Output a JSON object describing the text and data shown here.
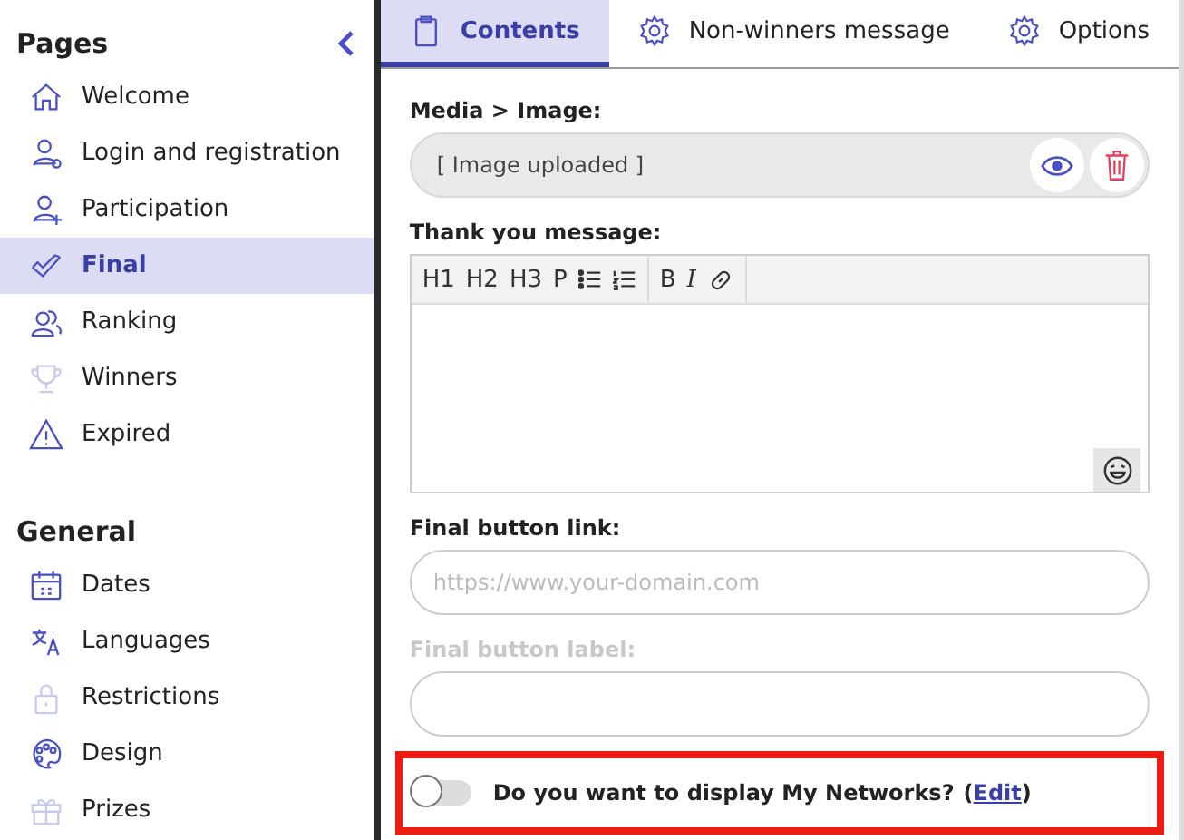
{
  "sidebar": {
    "sections": [
      {
        "title": "Pages",
        "items": [
          {
            "label": "Welcome",
            "icon_dimmed": false,
            "selected": false
          },
          {
            "label": "Login and registration",
            "icon_dimmed": false,
            "selected": false
          },
          {
            "label": "Participation",
            "icon_dimmed": false,
            "selected": false
          },
          {
            "label": "Final",
            "icon_dimmed": false,
            "selected": true
          },
          {
            "label": "Ranking",
            "icon_dimmed": false,
            "selected": false
          },
          {
            "label": "Winners",
            "icon_dimmed": true,
            "selected": false
          },
          {
            "label": "Expired",
            "icon_dimmed": false,
            "selected": false
          }
        ]
      },
      {
        "title": "General",
        "items": [
          {
            "label": "Dates",
            "icon_dimmed": false,
            "selected": false
          },
          {
            "label": "Languages",
            "icon_dimmed": false,
            "selected": false
          },
          {
            "label": "Restrictions",
            "icon_dimmed": true,
            "selected": false
          },
          {
            "label": "Design",
            "icon_dimmed": false,
            "selected": false
          },
          {
            "label": "Prizes",
            "icon_dimmed": true,
            "selected": false
          }
        ]
      }
    ]
  },
  "tabs": [
    {
      "label": "Contents",
      "selected": true
    },
    {
      "label": "Non-winners message",
      "selected": false
    },
    {
      "label": "Options",
      "selected": false
    }
  ],
  "media": {
    "label": "Media > Image:",
    "value": "[ Image uploaded ]"
  },
  "editor": {
    "label": "Thank you message:",
    "tools": [
      {
        "kind": "text",
        "label": "H1"
      },
      {
        "kind": "text",
        "label": "H2"
      },
      {
        "kind": "text",
        "label": "H3"
      },
      {
        "kind": "text",
        "label": "P"
      },
      {
        "kind": "bullets"
      },
      {
        "kind": "numbers"
      },
      {
        "kind": "separator"
      },
      {
        "kind": "text",
        "label": "B"
      },
      {
        "kind": "italic",
        "label": "I"
      },
      {
        "kind": "link"
      }
    ]
  },
  "fields": [
    {
      "label": "Final button link:",
      "placeholder": "https://www.your-domain.com",
      "disabled": false
    },
    {
      "label": "Final button label:",
      "disabled": true
    }
  ],
  "networks": {
    "on": false,
    "highlighted": true,
    "question": "Do you want to display My Networks?",
    "open_paren": "(",
    "link": "Edit",
    "close_paren": ")"
  }
}
